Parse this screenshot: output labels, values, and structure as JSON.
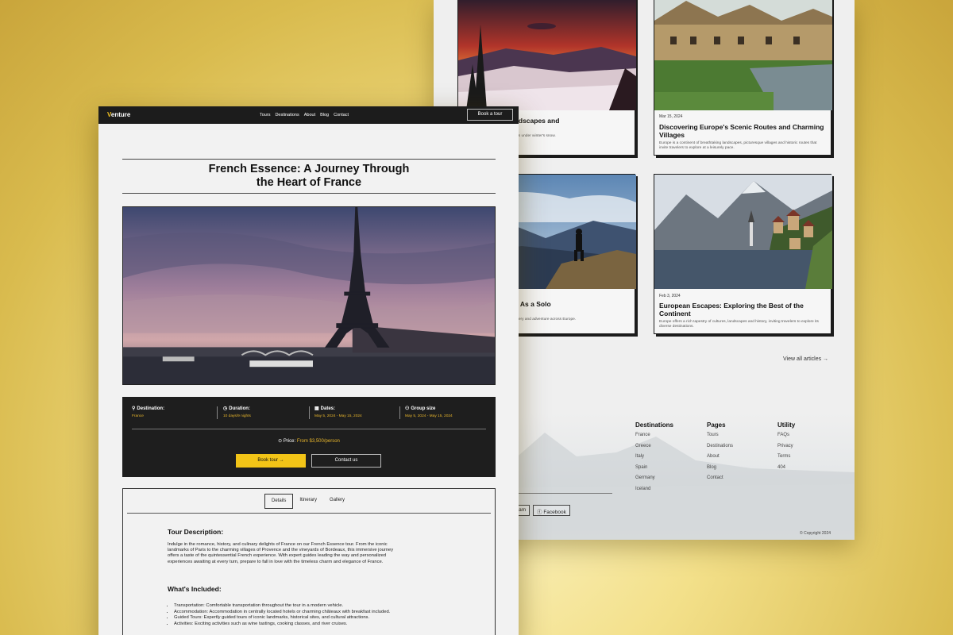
{
  "back": {
    "cards": [
      {
        "title_partial": "gic of Snowy Landscapes and",
        "meta": "",
        "desc": "Europe's breathtaking landscapes under winter's snow."
      },
      {
        "title": "Discovering Europe's Scenic Routes and Charming Villages",
        "meta": "Mar 15, 2024",
        "desc": "Europe is a continent of breathtaking landscapes, picturesque villages and historic routes that invite travelers to explore at a leisurely pace."
      },
      {
        "title_partial": "ing the Continent As a Solo",
        "meta": "",
        "desc": "An essential guide for self discovery and adventure across Europe."
      },
      {
        "title": "European Escapes: Exploring the Best of the Continent",
        "meta": "Feb 3, 2024",
        "desc": "Europe offers a rich tapestry of cultures, landscapes and history, inviting travelers to explore its diverse destinations."
      }
    ],
    "view_all": "View all articles →",
    "footer": {
      "columns": [
        {
          "heading": "Destinations",
          "items": [
            "France",
            "Greece",
            "Italy",
            "Spain",
            "Germany",
            "Iceland"
          ]
        },
        {
          "heading": "Pages",
          "items": [
            "Tours",
            "Destinations",
            "About",
            "Blog",
            "Contact"
          ]
        },
        {
          "heading": "Utility",
          "items": [
            "FAQs",
            "Privacy",
            "Terms",
            "404"
          ]
        }
      ],
      "social_partial": "ram",
      "social_facebook": "Facebook",
      "copyright": "© Copyright 2024"
    }
  },
  "front": {
    "logo_first": "V",
    "logo_rest": "enture",
    "nav": [
      "Tours",
      "Destinations",
      "About",
      "Blog",
      "Contact"
    ],
    "nav_cta": "Book a tour",
    "title_line1": "French Essence: A Journey Through",
    "title_line2": "the Heart of France",
    "info": [
      {
        "label": "Destination:",
        "value": "France",
        "icon": "⚲"
      },
      {
        "label": "Duration:",
        "value": "10 days/9 nights",
        "icon": "◷"
      },
      {
        "label": "Dates:",
        "value": "May 5, 2024 - May 15, 2024",
        "icon": "▦"
      },
      {
        "label": "Group size",
        "value": "May 5, 2024 - May 15, 2024",
        "icon": "⚇"
      }
    ],
    "price_label": "Price:",
    "price_value": "From $3,500/person",
    "btn_book": "Book tour →",
    "btn_contact": "Contact us",
    "tabs": [
      "Details",
      "Itinerary",
      "Gallery"
    ],
    "desc_heading": "Tour Description:",
    "desc_text": "Indulge in the romance, history, and culinary delights of France on our French Essence tour. From the iconic landmarks of Paris to the charming villages of Provence and the vineyards of Bordeaux, this immersive journey offers a taste of the quintessential French experience. With expert guides leading the way and personalized experiences awaiting at every turn, prepare to fall in love with the timeless charm and elegance of France.",
    "included_heading": "What's Included:",
    "included": [
      "Transportation: Comfortable transportation throughout the tour in a modern vehicle.",
      "Accommodation: Accommodation in centrally located hotels or charming châteaux with breakfast included.",
      "Guided Tours: Expertly guided tours of iconic landmarks, historical sites, and cultural attractions.",
      "Activities: Exciting activities such as wine tastings, cooking classes, and river cruises."
    ]
  }
}
